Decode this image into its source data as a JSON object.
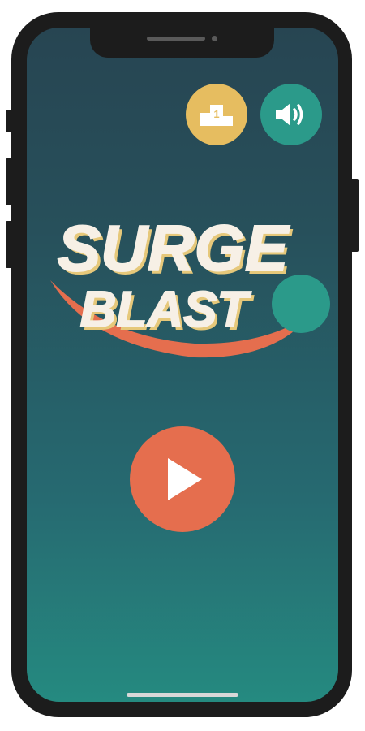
{
  "game": {
    "title_line1": "SURGE",
    "title_line2": "BLAST"
  },
  "buttons": {
    "leaderboard_icon": "podium-icon",
    "leaderboard_rank": "1",
    "sound_icon": "speaker-volume-icon",
    "play_icon": "play-icon"
  },
  "colors": {
    "background_top": "#274552",
    "background_bottom": "#258a80",
    "accent_orange": "#e56e4e",
    "accent_yellow": "#e6bd60",
    "accent_teal": "#2b9a8a",
    "title_text": "#f7f0e6"
  }
}
